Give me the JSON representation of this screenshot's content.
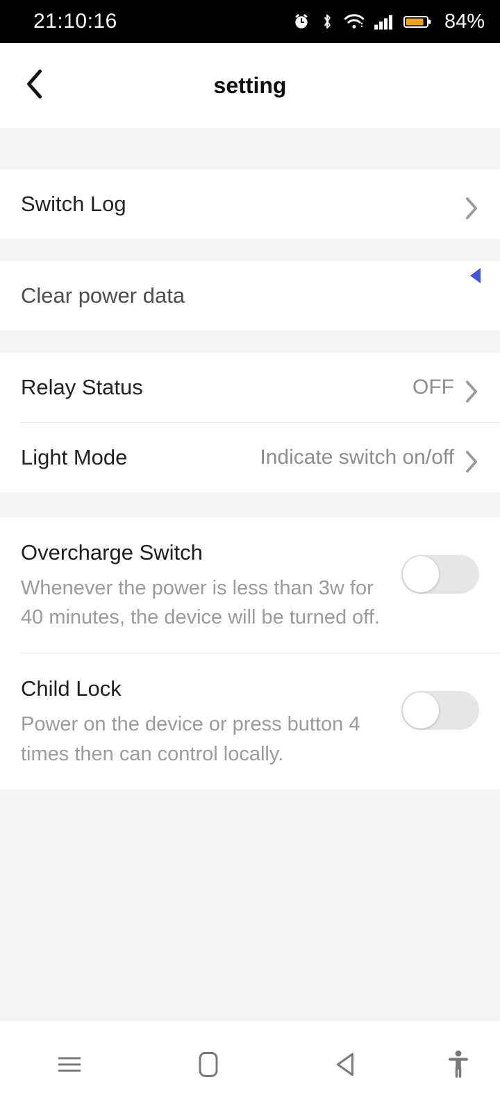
{
  "statusbar": {
    "time": "21:10:16",
    "battery_percent": "84%",
    "icons": [
      "alarm-icon",
      "bluetooth-icon",
      "wifi-icon",
      "cellular-signal-icon",
      "battery-icon"
    ]
  },
  "header": {
    "title": "setting",
    "back_icon": "chevron-left-icon"
  },
  "sections": [
    {
      "rows": [
        {
          "label": "Switch Log",
          "value": "",
          "accessory": "chevron-right-icon"
        }
      ]
    },
    {
      "rows": [
        {
          "label": "Clear power data",
          "value": "",
          "accessory": "none",
          "marker": "blue-left-arrow"
        }
      ]
    },
    {
      "rows": [
        {
          "label": "Relay Status",
          "value": "OFF",
          "accessory": "chevron-right-icon"
        },
        {
          "label": "Light Mode",
          "value": "Indicate switch on/off",
          "accessory": "chevron-right-icon"
        }
      ]
    },
    {
      "rows": [
        {
          "title": "Overcharge Switch",
          "desc": "Whenever the power is less than 3w for 40 minutes, the device will be turned off.",
          "toggle": "off"
        },
        {
          "title": "Child Lock",
          "desc": "Power on the device or press button 4 times then can control locally.",
          "toggle": "off"
        }
      ]
    }
  ],
  "navbar": {
    "recents_label": "menu-icon",
    "home_label": "home-icon",
    "back_label": "back-triangle-icon",
    "accessibility_label": "accessibility-icon"
  },
  "colors": {
    "accent_blue": "#4355d0",
    "page_bg": "#f4f4f4",
    "card_bg": "#ffffff",
    "text_primary": "#222222",
    "text_secondary": "#9b9b9b",
    "toggle_track_off": "#e6e6e6",
    "battery_fill": "#e8a317"
  }
}
